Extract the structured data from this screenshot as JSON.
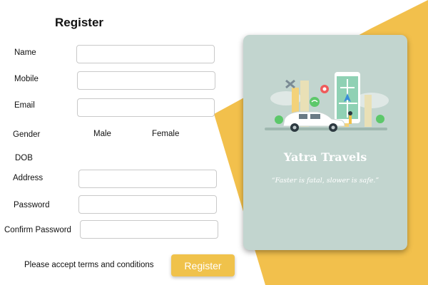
{
  "form": {
    "title": "Register",
    "fields": {
      "name": {
        "label": "Name",
        "value": ""
      },
      "mobile": {
        "label": "Mobile",
        "value": ""
      },
      "email": {
        "label": "Email",
        "value": ""
      },
      "gender": {
        "label": "Gender",
        "options": [
          "Male",
          "Female"
        ]
      },
      "dob": {
        "label": "DOB"
      },
      "address": {
        "label": "Address",
        "value": ""
      },
      "password": {
        "label": "Password",
        "value": ""
      },
      "confirm_password": {
        "label": "Confirm Password",
        "value": ""
      }
    },
    "terms_text": "Please accept terms and conditions",
    "submit_label": "Register"
  },
  "card": {
    "brand": "Yatra Travels",
    "tagline": "“Faster is fatal, slower is safe.”"
  },
  "colors": {
    "accent": "#f0c24b",
    "card_bg": "#c2d5cf",
    "shape": "#f2c04c"
  }
}
